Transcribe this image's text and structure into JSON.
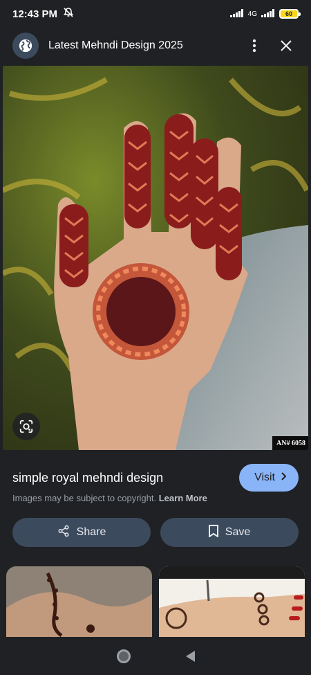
{
  "status": {
    "time": "12:43 PM",
    "network": "4G",
    "battery": "60"
  },
  "header": {
    "title": "Latest Mehndi Design 2025"
  },
  "image": {
    "watermark": "AN# 6058"
  },
  "caption": {
    "title": "simple royal mehndi design",
    "visit_label": "Visit",
    "copyright_text": "Images may be subject to copyright.",
    "learn_more": "Learn More"
  },
  "actions": {
    "share_label": "Share",
    "save_label": "Save"
  },
  "icons": {
    "globe": "globe-icon",
    "menu": "more-vert-icon",
    "close": "close-icon",
    "lens": "lens-icon",
    "share": "share-icon",
    "save": "bookmark-icon",
    "chevron": "chevron-right-icon"
  },
  "colors": {
    "background": "#202124",
    "accent": "#8ab4f8",
    "button": "#3c4a5e"
  }
}
